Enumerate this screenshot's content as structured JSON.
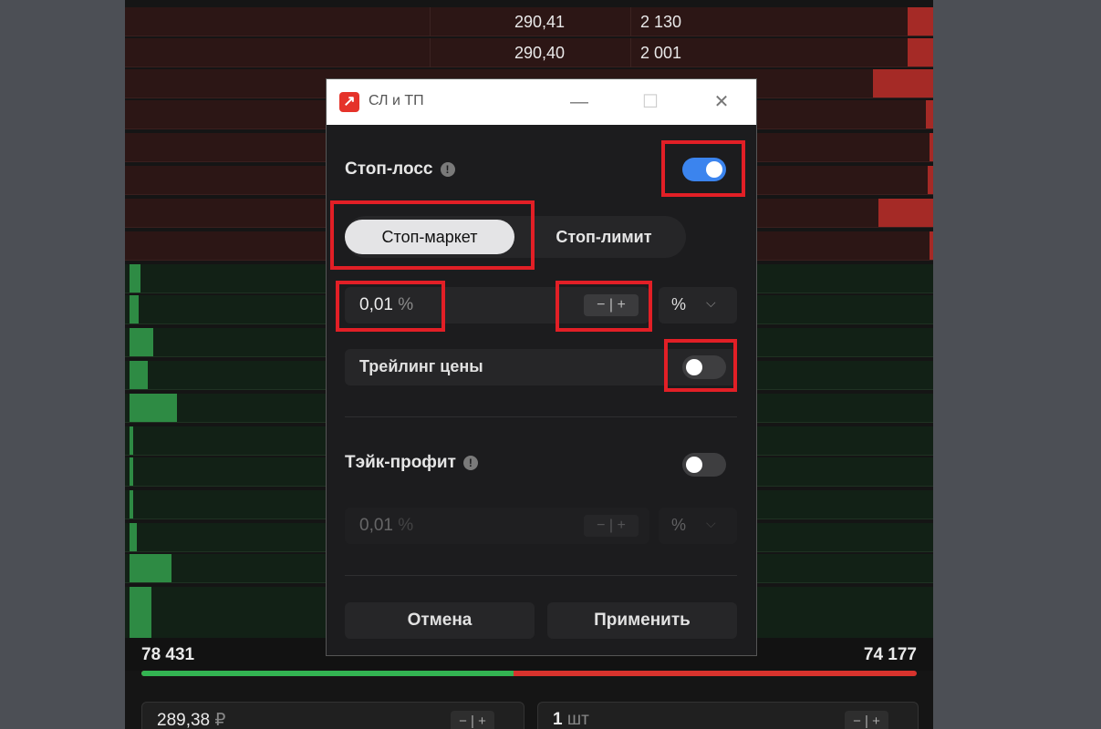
{
  "order_book": {
    "asks": [
      {
        "price": "290,41",
        "qty": "2 130"
      },
      {
        "price": "290,40",
        "qty": "2 001"
      }
    ],
    "ask_level_count": 9,
    "bid_level_count": 13
  },
  "totals": {
    "bid_total": "78 431",
    "ask_total": "74 177",
    "bid_share": 0.48
  },
  "order_form": {
    "price_value": "289,38",
    "price_unit": "₽",
    "qty_value": "1",
    "qty_unit": "шт",
    "stepper_minus": "−",
    "stepper_plus": "+"
  },
  "dialog": {
    "title": "СЛ и ТП",
    "app_icon": "arrow-up-right-icon",
    "window_buttons": {
      "minimize": "—",
      "maximize": "☐",
      "close": "✕"
    },
    "stop_loss": {
      "label": "Стоп-лосс",
      "enabled": true,
      "order_types": {
        "active": "Стоп-маркет",
        "inactive": "Стоп-лимит"
      },
      "value": "0,01",
      "value_unit": "%",
      "unit_select": "%",
      "trailing_label": "Трейлинг цены",
      "trailing_enabled": false
    },
    "take_profit": {
      "label": "Тэйк-профит",
      "enabled": false,
      "value": "0,01",
      "value_unit": "%",
      "unit_select": "%"
    },
    "buttons": {
      "cancel": "Отмена",
      "apply": "Применить"
    }
  },
  "colors": {
    "ask": "#a52a26",
    "bid": "#2e8b44",
    "toggle_on": "#3b84ee",
    "highlight": "#e21f26"
  }
}
